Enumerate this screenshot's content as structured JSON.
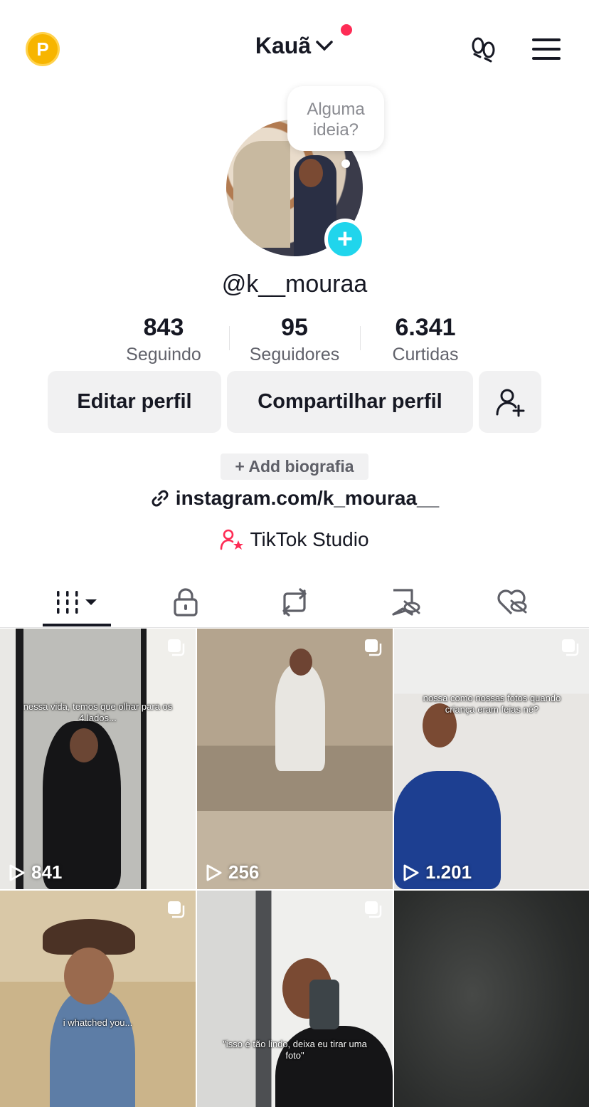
{
  "header": {
    "coin_letter": "P",
    "username": "Kauã",
    "steps_icon": "footprints-icon",
    "menu_icon": "hamburger-menu-icon"
  },
  "profile": {
    "bubble_text": "Alguma ideia?",
    "handle": "@k__mouraa"
  },
  "stats": [
    {
      "value": "843",
      "label": "Seguindo"
    },
    {
      "value": "95",
      "label": "Seguidores"
    },
    {
      "value": "6.341",
      "label": "Curtidas"
    }
  ],
  "actions": {
    "edit": "Editar perfil",
    "share": "Compartilhar perfil"
  },
  "bio": {
    "add_label": "+ Add biografia",
    "link": "instagram.com/k_mouraa__",
    "studio": "TikTok Studio"
  },
  "tabs": [
    "videos-grid-icon",
    "lock-icon",
    "repost-icon",
    "favorites-hidden-icon",
    "liked-hidden-icon"
  ],
  "videos": [
    {
      "caption": "nessa vida, temos que olhar para os 4 lados...",
      "views": "841"
    },
    {
      "caption": "",
      "views": "256"
    },
    {
      "caption": "nossa como nossas fotos quando criança eram feias né?",
      "views": "1.201"
    },
    {
      "caption": "i whatched you...",
      "views": ""
    },
    {
      "caption": "\"isso é tão lindo, deixa eu tirar uma foto\"",
      "views": ""
    },
    {
      "caption": "",
      "views": ""
    }
  ],
  "colors": {
    "accent": "#fe2c55",
    "plus": "#20d5ec",
    "coin": "#f7b500"
  }
}
